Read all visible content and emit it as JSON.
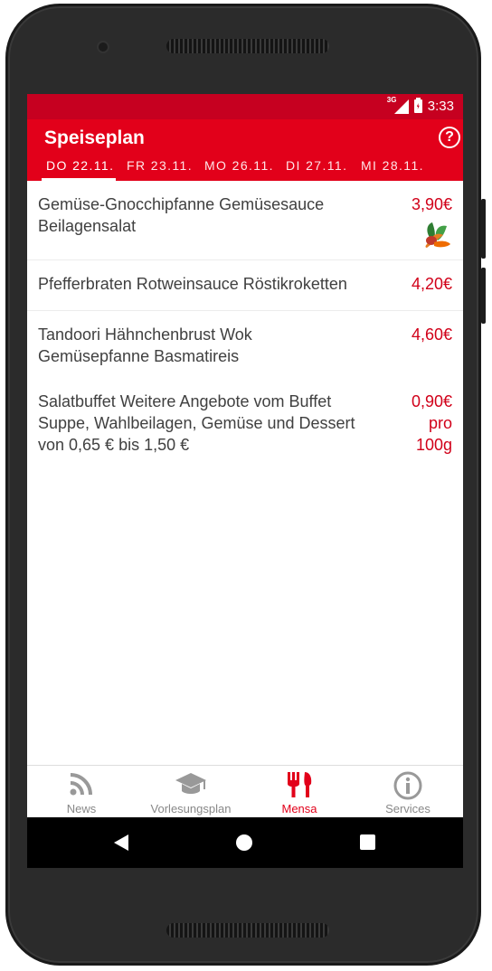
{
  "status_bar": {
    "network": "3G",
    "time": "3:33"
  },
  "app_bar": {
    "title": "Speiseplan",
    "help_icon": "help-circle-icon"
  },
  "tabs": [
    {
      "label": "DO 22.11.",
      "selected": true
    },
    {
      "label": "FR 23.11.",
      "selected": false
    },
    {
      "label": "MO 26.11.",
      "selected": false
    },
    {
      "label": "DI 27.11.",
      "selected": false
    },
    {
      "label": "MI 28.11.",
      "selected": false
    }
  ],
  "menu": [
    {
      "name_lines": [
        "Gemüse-Gnocchipfanne Gemüsesauce",
        "Beilagensalat"
      ],
      "price_lines": [
        "3,90€"
      ],
      "icon": "vegetarian-icon"
    },
    {
      "name_lines": [
        "Pfefferbraten Rotweinsauce Röstikroketten"
      ],
      "price_lines": [
        "4,20€"
      ]
    },
    {
      "name_lines": [
        "Tandoori Hähnchenbrust Wok",
        "Gemüsepfanne Basmatireis"
      ],
      "price_lines": [
        "4,60€"
      ]
    },
    {
      "name_lines": [
        "Salatbuffet Weitere Angebote vom Buffet",
        "Suppe, Wahlbeilagen, Gemüse und Dessert",
        "von 0,65 € bis 1,50 €"
      ],
      "price_lines": [
        "0,90€",
        "pro",
        "100g"
      ]
    }
  ],
  "bottom_nav": [
    {
      "label": "News",
      "icon": "rss-icon",
      "active": false
    },
    {
      "label": "Vorlesungsplan",
      "icon": "graduation-cap-icon",
      "active": false
    },
    {
      "label": "Mensa",
      "icon": "fork-knife-icon",
      "active": true
    },
    {
      "label": "Services",
      "icon": "info-icon",
      "active": false
    }
  ],
  "colors": {
    "primary": "#e2001a",
    "status_bar": "#c60020",
    "price": "#d10019",
    "text": "#404040",
    "nav_inactive": "#888888"
  }
}
